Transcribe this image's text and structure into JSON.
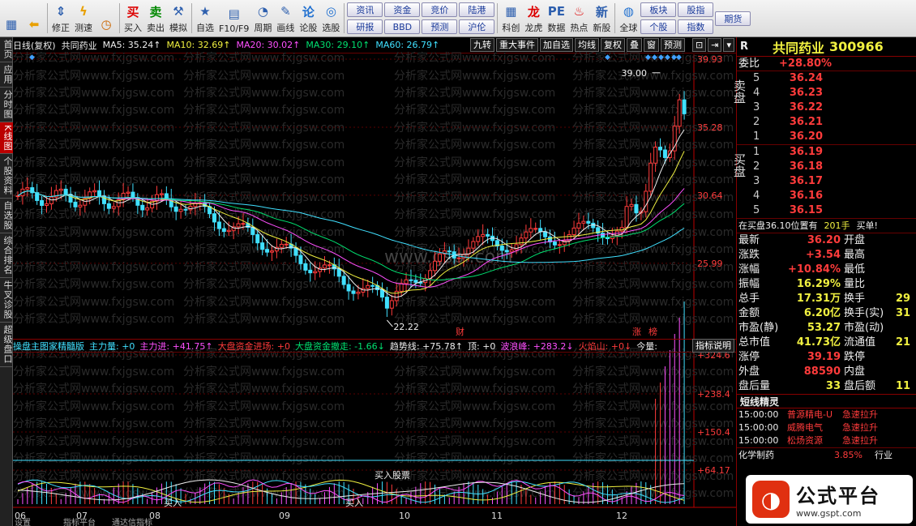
{
  "toolbar": {
    "buttons": [
      {
        "label": "",
        "icon": "grid-icon"
      },
      {
        "label": "",
        "icon": "back-arrow-icon"
      },
      {
        "label": "修正",
        "icon": "up-down-icon"
      },
      {
        "label": "测速",
        "icon": "lightning-icon"
      },
      {
        "label": "",
        "icon": "clock-icon"
      },
      {
        "label": "买入",
        "icon": "buy-icon"
      },
      {
        "label": "卖出",
        "icon": "sell-icon"
      },
      {
        "label": "模拟",
        "icon": "hammer-icon"
      },
      {
        "label": "自选",
        "icon": "star-folder-icon"
      },
      {
        "label": "F10/F9",
        "icon": "f10-icon"
      },
      {
        "label": "周期",
        "icon": "period-icon"
      },
      {
        "label": "画线",
        "icon": "pencil-icon"
      },
      {
        "label": "论股",
        "icon": "discuss-icon"
      },
      {
        "label": "选股",
        "icon": "select-stock-icon"
      }
    ],
    "grid_buttons": [
      [
        "资讯",
        "研报"
      ],
      [
        "资金",
        "BBD"
      ],
      [
        "竞价",
        "预测"
      ],
      [
        "陆港",
        "沪伦"
      ]
    ],
    "right_buttons": [
      {
        "label": "科创",
        "icon": "chart-icon"
      },
      {
        "label": "龙虎",
        "icon": "dragon-icon"
      },
      {
        "label": "数据",
        "icon": "pe-icon"
      },
      {
        "label": "热点",
        "icon": "fire-icon"
      },
      {
        "label": "新股",
        "icon": "new-stock-icon"
      },
      {
        "label": "全球",
        "icon": "globe-icon"
      }
    ],
    "grid_buttons2": [
      [
        "板块",
        "个股"
      ],
      [
        "股指",
        "指数"
      ],
      [
        "期货",
        ""
      ]
    ]
  },
  "left_tabs": [
    "首页",
    "应用",
    "分时图",
    "K线图",
    "个股资料",
    "自选股",
    "综合排名",
    "牛叉诊股",
    "超级盘口"
  ],
  "left_tabs_active": 3,
  "chart_header": {
    "period": "日线(复权)",
    "stock": "共同药业",
    "ma5": "MA5: 35.24↑",
    "ma10": "MA10: 32.69↑",
    "ma20": "MA20: 30.02↑",
    "ma30": "MA30: 29.10↑",
    "ma60": "MA60: 26.79↑",
    "buttons": [
      "九转",
      "重大事件",
      "加自选",
      "均线",
      "复权",
      "叠",
      "窗",
      "预测"
    ]
  },
  "price_axis": [
    "39.93",
    "35.28",
    "30.64",
    "25.99"
  ],
  "indicator_axis": [
    "+324.6",
    "+238.4",
    "+150.4",
    "+64.17"
  ],
  "date_axis": [
    "06",
    "07",
    "08",
    "09",
    "10",
    "11",
    "12"
  ],
  "annotations": {
    "high": "39.00",
    "low": "22.22",
    "cai": "财",
    "zhang": "涨",
    "bang": "榜",
    "buy1": "买入",
    "buy2": "买入",
    "buy3": "买入股票"
  },
  "watermark": "分析家公式网www.fxjgsw.com",
  "watermark2": "www.gspf.com",
  "indicator_bar": {
    "name": "操盘主图家精髓版",
    "items": [
      {
        "t": "主力量: +0",
        "c": "cyan"
      },
      {
        "t": "主力进: +41.75↑",
        "c": "mag"
      },
      {
        "t": "大盘资金进场: +0",
        "c": "red"
      },
      {
        "t": "大盘资金撤走: -1.66↓",
        "c": "grn"
      },
      {
        "t": "趋势线: +75.78↑",
        "c": "wht"
      },
      {
        "t": "顶: +0",
        "c": "wht"
      },
      {
        "t": "波浪峰: +283.2↓",
        "c": "mag"
      },
      {
        "t": "火焰山: +0↓",
        "c": "red"
      },
      {
        "t": "今量:",
        "c": "wht"
      }
    ],
    "explain": "指标说明"
  },
  "quote": {
    "code": "R",
    "name": "共同药业",
    "number": "300966",
    "weibi_label": "委比",
    "weibi": "+28.80%",
    "sell_label": "卖盘",
    "buy_label": "买盘",
    "asks": [
      {
        "l": "5",
        "p": "36.24"
      },
      {
        "l": "4",
        "p": "36.23"
      },
      {
        "l": "3",
        "p": "36.22"
      },
      {
        "l": "2",
        "p": "36.21"
      },
      {
        "l": "1",
        "p": "36.20"
      }
    ],
    "bids": [
      {
        "l": "1",
        "p": "36.19"
      },
      {
        "l": "2",
        "p": "36.18"
      },
      {
        "l": "3",
        "p": "36.17"
      },
      {
        "l": "4",
        "p": "36.16"
      },
      {
        "l": "5",
        "p": "36.15"
      }
    ],
    "notice": "在买盘36.10位置有",
    "notice_vol": "201手",
    "notice_act": "买单!",
    "stats": [
      {
        "l": "最新",
        "v": "36.20",
        "c": "red",
        "r": "开盘"
      },
      {
        "l": "涨跌",
        "v": "+3.54",
        "c": "red",
        "r": "最高"
      },
      {
        "l": "涨幅",
        "v": "+10.84%",
        "c": "red",
        "r": "最低"
      },
      {
        "l": "振幅",
        "v": "16.29%",
        "c": "yel",
        "r": "量比"
      },
      {
        "l": "总手",
        "v": "17.31万",
        "c": "yel",
        "r": "换手",
        "rv": "29"
      },
      {
        "l": "金额",
        "v": "6.20亿",
        "c": "yel",
        "r": "换手(实)",
        "rv": "31"
      },
      {
        "l": "市盈(静)",
        "v": "53.27",
        "c": "yel",
        "r": "市盈(动)"
      },
      {
        "l": "总市值",
        "v": "41.73亿",
        "c": "yel",
        "r": "流通值",
        "rv": "21"
      },
      {
        "l": "涨停",
        "v": "39.19",
        "c": "red",
        "r": "跌停"
      },
      {
        "l": "外盘",
        "v": "88590",
        "c": "red",
        "r": "内盘"
      },
      {
        "l": "盘后量",
        "v": "33",
        "c": "yel",
        "r": "盘后额",
        "rv": "11"
      }
    ],
    "short_title": "短线精灵",
    "short_items": [
      {
        "t": "15:00:00",
        "n": "普源精电-U",
        "e": "急速拉升"
      },
      {
        "t": "15:00:00",
        "n": "威腾电气",
        "e": "急速拉升"
      },
      {
        "t": "15:00:00",
        "n": "松炀资源",
        "e": "急速拉升"
      }
    ],
    "bottom_row": {
      "n": "化学制药",
      "v": "3.85%",
      "e": "行业"
    }
  },
  "logo": {
    "text": "公式平台",
    "url": "www.gspt.com"
  },
  "bottom_tabs": [
    "设置",
    "指标平台",
    "通达信指标"
  ],
  "chart_data": {
    "type": "candlestick",
    "x": [
      "06",
      "07",
      "08",
      "09",
      "10",
      "11",
      "12"
    ],
    "ylim": [
      22.22,
      39.93
    ],
    "high": 39.0,
    "low": 22.22,
    "close": 36.2,
    "series": [
      {
        "name": "MA5",
        "value": 35.24
      },
      {
        "name": "MA10",
        "value": 32.69
      },
      {
        "name": "MA20",
        "value": 30.02
      },
      {
        "name": "MA30",
        "value": 29.1
      },
      {
        "name": "MA60",
        "value": 26.79
      }
    ]
  }
}
